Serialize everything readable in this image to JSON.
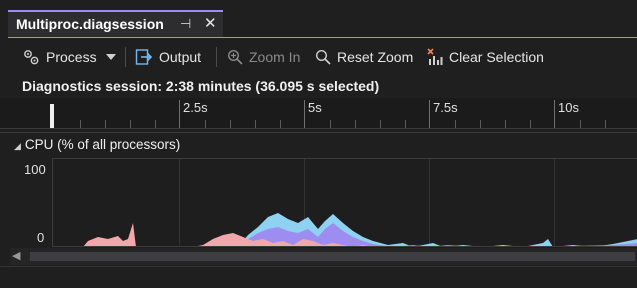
{
  "tab": {
    "title": "Multiproc.diagsession",
    "pin_glyph": "⊣",
    "close_glyph": "✕"
  },
  "toolbar": {
    "process_label": "Process",
    "output_label": "Output",
    "zoom_in_label": "Zoom In",
    "reset_zoom_label": "Reset Zoom",
    "clear_selection_label": "Clear Selection"
  },
  "session": {
    "text": "Diagnostics session: 2:38 minutes (36.095 s selected)"
  },
  "ruler": {
    "ticks": [
      "2.5s",
      "5s",
      "7.5s",
      "10s"
    ]
  },
  "cpu": {
    "title": "CPU (% of all processors)",
    "y_max_label": "100",
    "y_min_label": "0"
  },
  "colors": {
    "accent": "#9d8df1",
    "series_pink": "#f2a7ad",
    "series_blue": "#8fd1f1",
    "series_purple": "#9d8df1"
  }
}
